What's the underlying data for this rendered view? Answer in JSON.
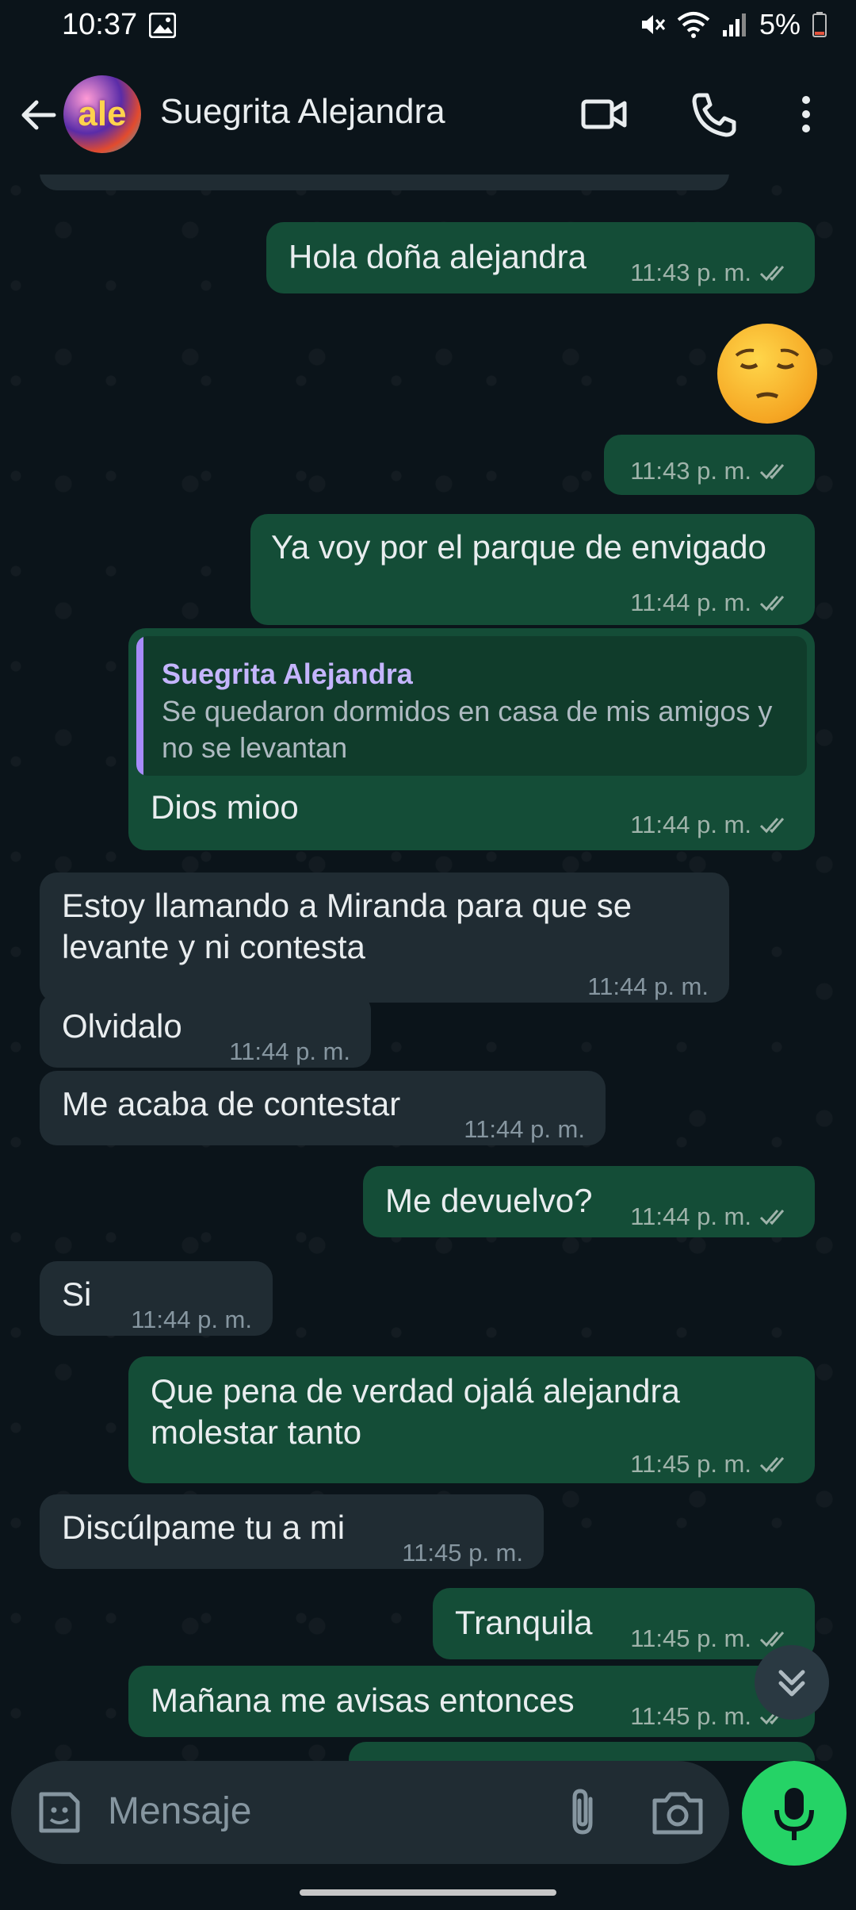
{
  "status_bar": {
    "time": "10:37",
    "battery": "5%"
  },
  "header": {
    "contact_name": "Suegrita Alejandra",
    "avatar_text": "ale"
  },
  "messages": [
    {
      "dir": "out",
      "text": "Hola doña alejandra",
      "time": "11:43 p. m."
    },
    {
      "dir": "out",
      "emoji": "pensive-face",
      "time": "11:43 p. m."
    },
    {
      "dir": "out",
      "text": "Ya voy por el parque de envigado",
      "time": "11:44 p. m."
    },
    {
      "dir": "out",
      "quote_author": "Suegrita Alejandra",
      "quote_text": "Se quedaron dormidos en casa de mis amigos y no se levantan",
      "text": "Dios mioo",
      "time": "11:44 p. m."
    },
    {
      "dir": "in",
      "text": "Estoy llamando a Miranda para que se levante y ni contesta",
      "time": "11:44 p. m."
    },
    {
      "dir": "in",
      "text": "Olvidalo",
      "time": "11:44 p. m."
    },
    {
      "dir": "in",
      "text": "Me acaba de contestar",
      "time": "11:44 p. m."
    },
    {
      "dir": "out",
      "text": "Me devuelvo?",
      "time": "11:44 p. m."
    },
    {
      "dir": "in",
      "text": "Si",
      "time": "11:44 p. m."
    },
    {
      "dir": "out",
      "text": "Que pena de verdad ojalá alejandra molestar tanto",
      "time": "11:45 p. m."
    },
    {
      "dir": "in",
      "text": "Discúlpame tu a mi",
      "time": "11:45 p. m."
    },
    {
      "dir": "out",
      "text": "Tranquila",
      "time": "11:45 p. m."
    },
    {
      "dir": "out",
      "text": "Mañana me avisas entonces",
      "time": "11:45 p. m."
    }
  ],
  "composer": {
    "placeholder": "Mensaje"
  },
  "colors": {
    "outgoing": "#144d37",
    "incoming": "#202c33",
    "accent": "#25d366",
    "read_ticks": "#53bdeb"
  }
}
